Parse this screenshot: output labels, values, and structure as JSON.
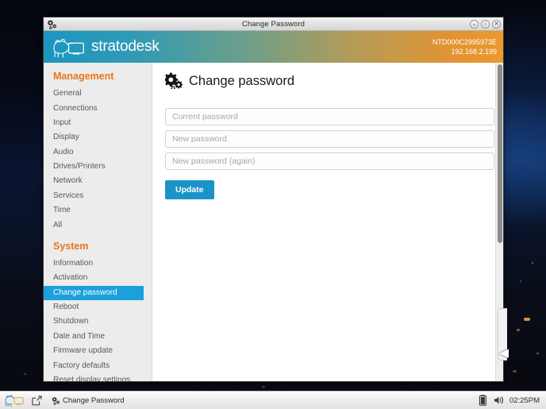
{
  "window": {
    "title": "Change Password",
    "titlebar_icon": "gears-icon",
    "controls": {
      "minimize": "⌄",
      "maximize": "○",
      "close": "✕"
    }
  },
  "brand": {
    "logo_icon": "polar-bear-monitor-logo",
    "wordmark": "stratodesk",
    "hostname": "NTD000C2995973E",
    "ip_address": "192.168.2.199",
    "gradient_start": "#1c96c0",
    "gradient_end": "#eb9a2d"
  },
  "sidebar": {
    "groups": [
      {
        "title": "Management",
        "items": [
          {
            "label": "General",
            "active": false
          },
          {
            "label": "Connections",
            "active": false
          },
          {
            "label": "Input",
            "active": false
          },
          {
            "label": "Display",
            "active": false
          },
          {
            "label": "Audio",
            "active": false
          },
          {
            "label": "Drives/Printers",
            "active": false
          },
          {
            "label": "Network",
            "active": false
          },
          {
            "label": "Services",
            "active": false
          },
          {
            "label": "Time",
            "active": false
          },
          {
            "label": "All",
            "active": false
          }
        ]
      },
      {
        "title": "System",
        "items": [
          {
            "label": "Information",
            "active": false
          },
          {
            "label": "Activation",
            "active": false
          },
          {
            "label": "Change password",
            "active": true
          },
          {
            "label": "Reboot",
            "active": false
          },
          {
            "label": "Shutdown",
            "active": false
          },
          {
            "label": "Date and Time",
            "active": false
          },
          {
            "label": "Firmware update",
            "active": false
          },
          {
            "label": "Factory defaults",
            "active": false
          },
          {
            "label": "Reset display settings",
            "active": false
          }
        ]
      }
    ],
    "group_title_color": "#e8751a",
    "active_color": "#1ba0dc"
  },
  "main": {
    "heading_icon": "gears-icon",
    "heading": "Change password",
    "fields": [
      {
        "name": "current-password",
        "value": "",
        "placeholder": "Current password"
      },
      {
        "name": "new-password",
        "value": "",
        "placeholder": "New password"
      },
      {
        "name": "new-password-again",
        "value": "",
        "placeholder": "New password (again)"
      }
    ],
    "update_button": "Update",
    "update_button_color": "#1a93c8"
  },
  "taskbar": {
    "start_icon": "polar-bear-logo",
    "launcher_icon": "launch-external-icon",
    "task": {
      "icon": "gears-icon",
      "label": "Change Password"
    },
    "tray": {
      "battery_icon": "battery-icon",
      "volume_icon": "volume-icon",
      "clock": "02:25PM"
    }
  }
}
